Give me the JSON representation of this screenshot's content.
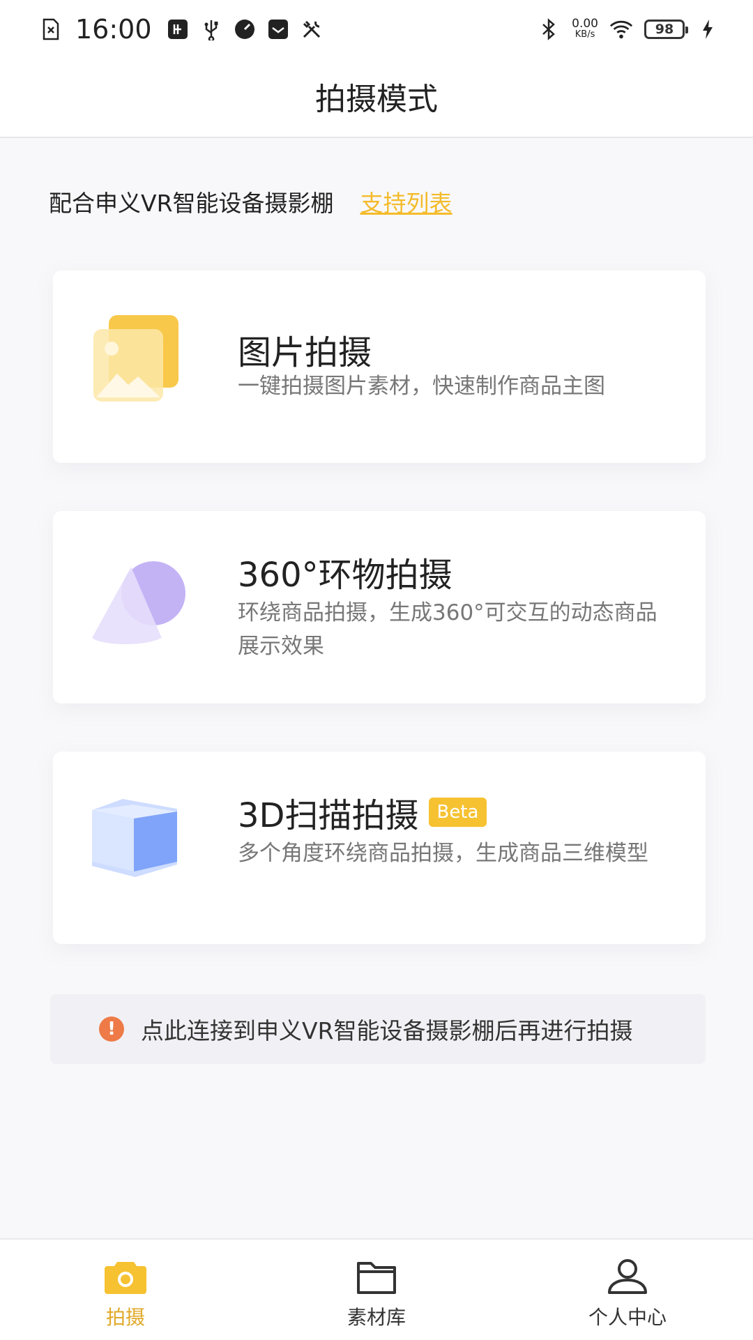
{
  "status_bar": {
    "time": "16:00",
    "net_speed": "0.00",
    "net_unit": "KB/s",
    "battery": "98"
  },
  "header": {
    "title": "拍摄模式"
  },
  "intro": {
    "text": "配合申义VR智能设备摄影棚",
    "link": "支持列表"
  },
  "modes": [
    {
      "title": "图片拍摄",
      "desc": "一键拍摄图片素材，快速制作商品主图"
    },
    {
      "title": "360°环物拍摄",
      "desc": "环绕商品拍摄，生成360°可交互的动态商品展示效果"
    },
    {
      "title": "3D扫描拍摄",
      "badge": "Beta",
      "desc": "多个角度环绕商品拍摄，生成商品三维模型"
    }
  ],
  "notice": {
    "text": "点此连接到申义VR智能设备摄影棚后再进行拍摄",
    "icon": "!"
  },
  "bottom_nav": [
    {
      "label": "拍摄",
      "active": true
    },
    {
      "label": "素材库",
      "active": false
    },
    {
      "label": "个人中心",
      "active": false
    }
  ],
  "colors": {
    "accent": "#f4bb2a",
    "beta_badge": "#f6c232",
    "warning": "#ee7a47",
    "active_tab": "#e0a92a"
  }
}
